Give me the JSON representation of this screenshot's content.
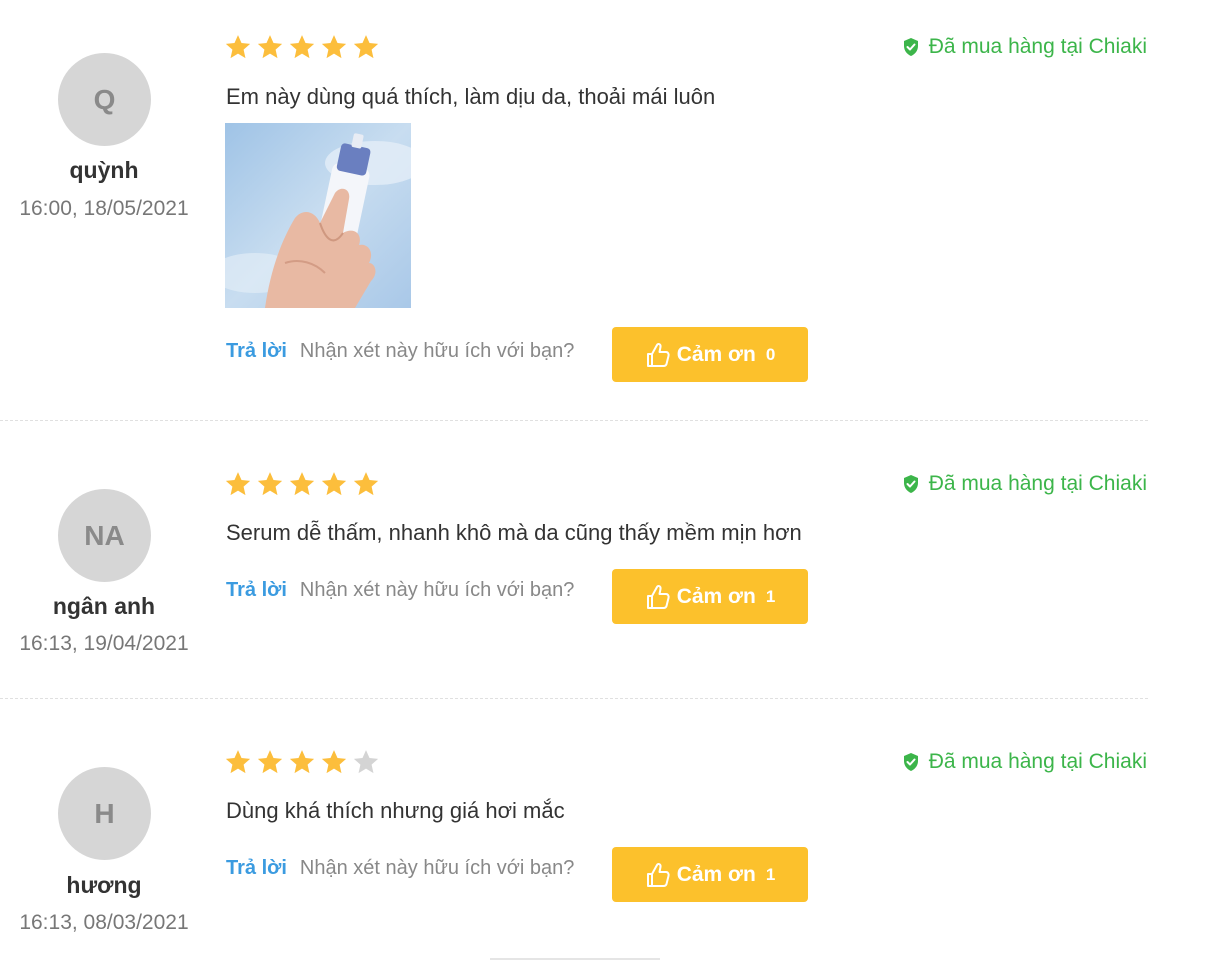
{
  "reviews": [
    {
      "initials": "Q",
      "name": "quỳnh",
      "date": "16:00, 18/05/2021",
      "rating": 5,
      "verified": "Đã mua hàng tại Chiaki",
      "comment": "Em này dùng quá thích, làm dịu da, thoải mái luôn",
      "has_photo": true,
      "reply": "Trả lời",
      "helpful_question": "Nhận xét này hữu ích với bạn?",
      "thanks_label": "Cảm ơn",
      "thanks_count": "0"
    },
    {
      "initials": "NA",
      "name": "ngân anh",
      "date": "16:13, 19/04/2021",
      "rating": 5,
      "verified": "Đã mua hàng tại Chiaki",
      "comment": "Serum dễ thấm, nhanh khô mà da cũng thấy mềm mịn hơn",
      "has_photo": false,
      "reply": "Trả lời",
      "helpful_question": "Nhận xét này hữu ích với bạn?",
      "thanks_label": "Cảm ơn",
      "thanks_count": "1"
    },
    {
      "initials": "H",
      "name": "hương",
      "date": "16:13, 08/03/2021",
      "rating": 4,
      "verified": "Đã mua hàng tại Chiaki",
      "comment": "Dùng khá thích nhưng giá hơi mắc",
      "has_photo": false,
      "reply": "Trả lời",
      "helpful_question": "Nhận xét này hữu ích với bạn?",
      "thanks_label": "Cảm ơn",
      "thanks_count": "1"
    }
  ],
  "colors": {
    "star_on": "#fcbe3c",
    "star_off": "#d4d4d4",
    "verified": "#3cb54a",
    "reply": "#3b9be0",
    "thanks_button": "#fcc12c"
  },
  "icons": {
    "star": "star-icon",
    "verified": "shield-check-icon",
    "thanks": "thumbs-up-icon"
  }
}
